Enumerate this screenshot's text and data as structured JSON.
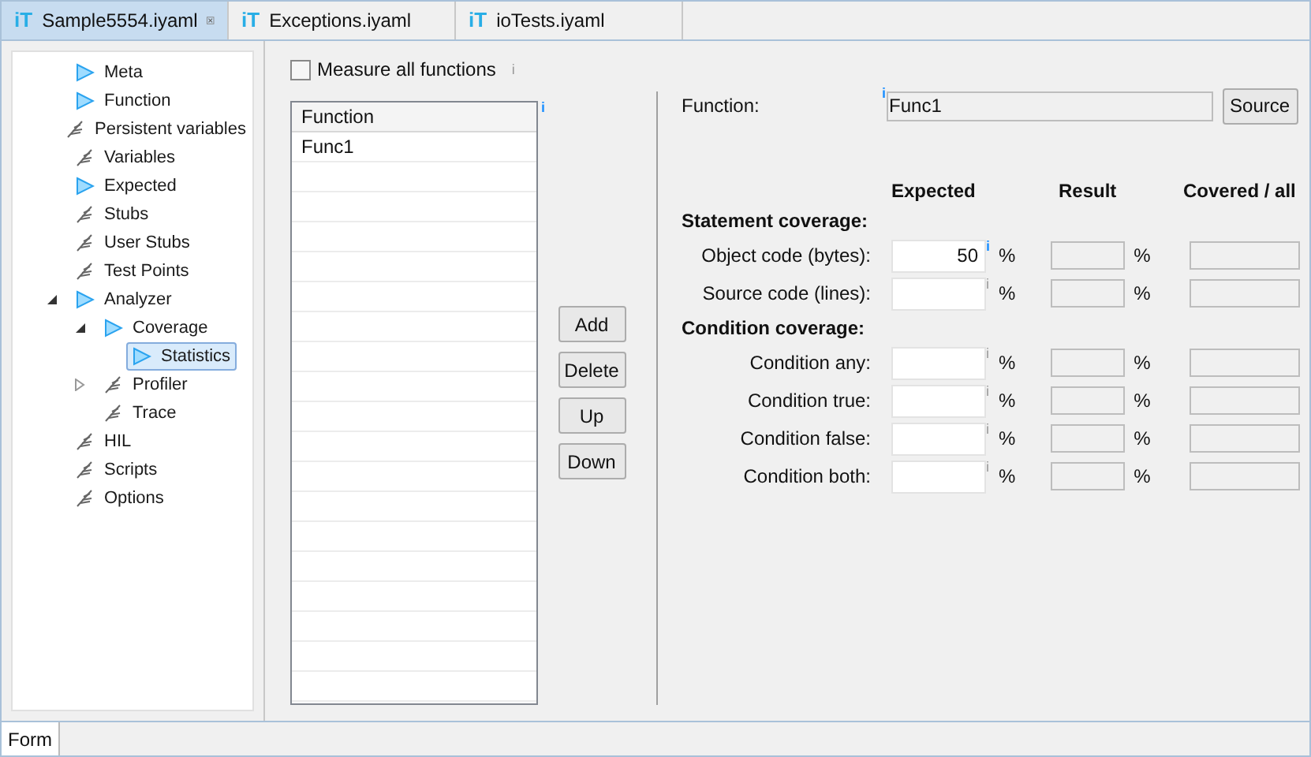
{
  "tabs": [
    {
      "icon": "iT",
      "label": "Sample5554.iyaml",
      "selected": true,
      "closable": true
    },
    {
      "icon": "iT",
      "label": "Exceptions.iyaml",
      "selected": false,
      "closable": false
    },
    {
      "icon": "iT",
      "label": "ioTests.iyaml",
      "selected": false,
      "closable": false
    }
  ],
  "tree": [
    {
      "label": "Meta",
      "kind": "active",
      "selected": false
    },
    {
      "label": "Function",
      "kind": "active",
      "selected": false
    },
    {
      "label": "Persistent variables",
      "kind": "inactive",
      "selected": false
    },
    {
      "label": "Variables",
      "kind": "inactive",
      "selected": false
    },
    {
      "label": "Expected",
      "kind": "active",
      "selected": false
    },
    {
      "label": "Stubs",
      "kind": "inactive",
      "selected": false
    },
    {
      "label": "User Stubs",
      "kind": "inactive",
      "selected": false
    },
    {
      "label": "Test Points",
      "kind": "inactive",
      "selected": false
    },
    {
      "label": "Analyzer",
      "kind": "active",
      "selected": false,
      "expanded": true,
      "children": [
        {
          "label": "Coverage",
          "kind": "active",
          "selected": false,
          "expanded": true,
          "children": [
            {
              "label": "Statistics",
              "kind": "active",
              "selected": true
            }
          ]
        },
        {
          "label": "Profiler",
          "kind": "inactive",
          "selected": false,
          "expanded": false
        },
        {
          "label": "Trace",
          "kind": "inactive",
          "selected": false
        }
      ]
    },
    {
      "label": "HIL",
      "kind": "inactive",
      "selected": false
    },
    {
      "label": "Scripts",
      "kind": "inactive",
      "selected": false
    },
    {
      "label": "Options",
      "kind": "inactive",
      "selected": false
    }
  ],
  "measure_all": {
    "label": "Measure all functions",
    "checked": false,
    "info": {
      "text": "i",
      "active": false
    }
  },
  "function_table": {
    "column": "Function",
    "rows": [
      "Func1"
    ],
    "info": {
      "text": "i",
      "active": true
    }
  },
  "list_buttons": [
    "Add",
    "Delete",
    "Up",
    "Down"
  ],
  "function_field": {
    "label": "Function:",
    "value": "Func1",
    "info": {
      "text": "i",
      "active": true
    },
    "button": "Source"
  },
  "columns": [
    "Expected",
    "Result",
    "Covered / all"
  ],
  "sections": [
    {
      "title": "Statement coverage:",
      "rows": [
        {
          "label": "Object code (bytes):",
          "value": "50",
          "unit": "%",
          "result_unit": "%",
          "info": {
            "text": "i",
            "active": true
          }
        },
        {
          "label": "Source code (lines):",
          "unit": "%",
          "result_unit": "%",
          "info": {
            "text": "i",
            "active": false
          }
        }
      ]
    },
    {
      "title": "Condition coverage:",
      "rows": [
        {
          "label": "Condition any:",
          "unit": "%",
          "result_unit": "%",
          "info": {
            "text": "i",
            "active": false
          }
        },
        {
          "label": "Condition true:",
          "unit": "%",
          "result_unit": "%",
          "info": {
            "text": "i",
            "active": false
          }
        },
        {
          "label": "Condition false:",
          "unit": "%",
          "result_unit": "%",
          "info": {
            "text": "i",
            "active": false
          }
        },
        {
          "label": "Condition both:",
          "unit": "%",
          "result_unit": "%",
          "info": {
            "text": "i",
            "active": false
          }
        }
      ]
    }
  ],
  "bottom_tab": {
    "label": "Form",
    "selected": true
  }
}
